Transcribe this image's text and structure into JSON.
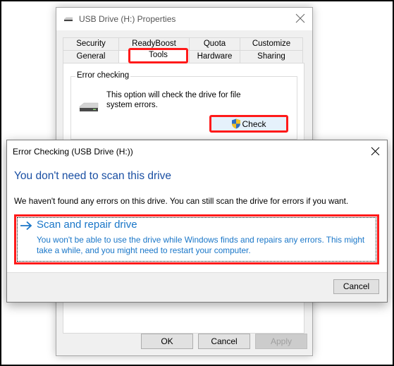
{
  "properties_window": {
    "title": "USB Drive (H:) Properties",
    "tabs_row1": [
      "Security",
      "ReadyBoost",
      "Quota",
      "Customize"
    ],
    "tabs_row2": [
      "General",
      "Tools",
      "Hardware",
      "Sharing"
    ],
    "active_tab": "Tools",
    "error_checking": {
      "group_label": "Error checking",
      "description": "This option will check the drive for file system errors.",
      "check_button": "Check"
    },
    "buttons": {
      "ok": "OK",
      "cancel": "Cancel",
      "apply": "Apply"
    }
  },
  "error_dialog": {
    "title": "Error Checking (USB Drive (H:))",
    "heading": "You don't need to scan this drive",
    "message": "We haven't found any errors on this drive. You can still scan the drive for errors if you want.",
    "option": {
      "title": "Scan and repair drive",
      "description": "You won't be able to use the drive while Windows finds and repairs any errors. This might take a while, and you might need to restart your computer."
    },
    "cancel_button": "Cancel"
  },
  "colors": {
    "highlight": "#ff1a1a",
    "heading_blue": "#1a4fa3",
    "link_blue": "#1976c8"
  }
}
